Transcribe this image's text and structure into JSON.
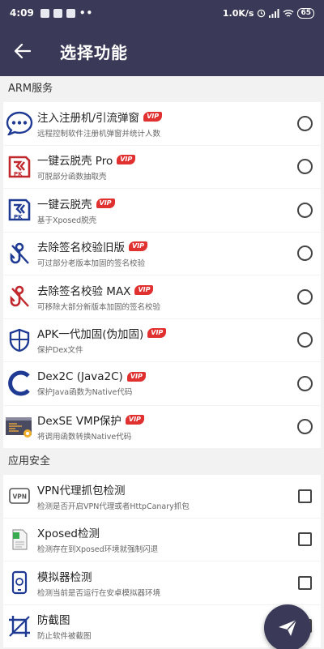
{
  "status_bar": {
    "time": "4:09",
    "dots": "••",
    "speed": "1.0K/s",
    "battery": "65"
  },
  "app_bar": {
    "title": "选择功能"
  },
  "sections": [
    {
      "title": "ARM服务",
      "items": [
        {
          "title": "注入注册机/引流弹窗",
          "subtitle": "远程控制软件注册机弹窗并统计人数",
          "vip": "VIP",
          "icon": "chat-dots-icon"
        },
        {
          "title": "一键云脱壳 Pro",
          "subtitle": "可脱部分函数抽取壳",
          "vip": "VIP",
          "icon": "pk-unpack-red-icon"
        },
        {
          "title": "一键云脱壳",
          "subtitle": "基于Xposed脱壳",
          "vip": "VIP",
          "icon": "pk-unpack-blue-icon"
        },
        {
          "title": "去除签名校验旧版",
          "subtitle": "可过部分老版本加固的签名校验",
          "vip": "VIP",
          "icon": "signature-hook-blue-icon"
        },
        {
          "title": "去除签名校验 MAX",
          "subtitle": "可移除大部分新版本加固的签名校验",
          "vip": "VIP",
          "icon": "signature-hook-red-icon"
        },
        {
          "title": "APK一代加固(伪加固)",
          "subtitle": "保护Dex文件",
          "vip": "VIP",
          "icon": "shield-icon"
        },
        {
          "title": "Dex2C (Java2C)",
          "subtitle": "保护Java函数为Native代码",
          "vip": "VIP",
          "icon": "c-letter-icon"
        },
        {
          "title": "DexSE VMP保护",
          "subtitle": "将调用函数转换Native代码",
          "vip": "VIP",
          "icon": "code-gear-icon"
        }
      ]
    },
    {
      "title": "应用安全",
      "items": [
        {
          "title": "VPN代理抓包检测",
          "subtitle": "检测是否开启VPN代理或者HttpCanary抓包",
          "icon": "vpn-icon"
        },
        {
          "title": "Xposed检测",
          "subtitle": "检测存在到Xposed环境就强制闪退",
          "icon": "xposed-file-icon"
        },
        {
          "title": "模拟器检测",
          "subtitle": "检测当前是否运行在安卓模拟器环境",
          "icon": "phone-icon"
        },
        {
          "title": "防截图",
          "subtitle": "防止软件被截图",
          "icon": "crop-icon"
        }
      ]
    }
  ],
  "colors": {
    "primary": "#3a3a58",
    "vip": "#e03030",
    "icon_blue": "#1f3a93",
    "icon_red": "#c0282d"
  }
}
